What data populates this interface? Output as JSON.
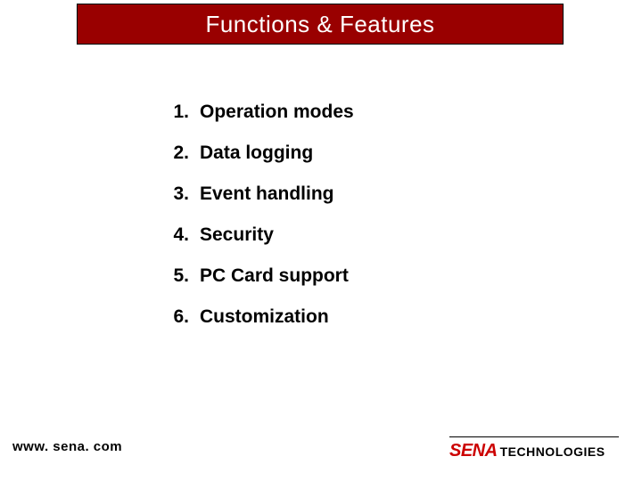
{
  "title": "Functions & Features",
  "items": [
    {
      "n": "1.",
      "label": "Operation modes"
    },
    {
      "n": "2.",
      "label": "Data logging"
    },
    {
      "n": "3.",
      "label": "Event handling"
    },
    {
      "n": "4.",
      "label": "Security"
    },
    {
      "n": "5.",
      "label": "PC Card support"
    },
    {
      "n": "6.",
      "label": "Customization"
    }
  ],
  "footer": {
    "url": "www. sena. com",
    "logo_primary": "SENA",
    "logo_secondary": "TECHNOLOGIES"
  }
}
